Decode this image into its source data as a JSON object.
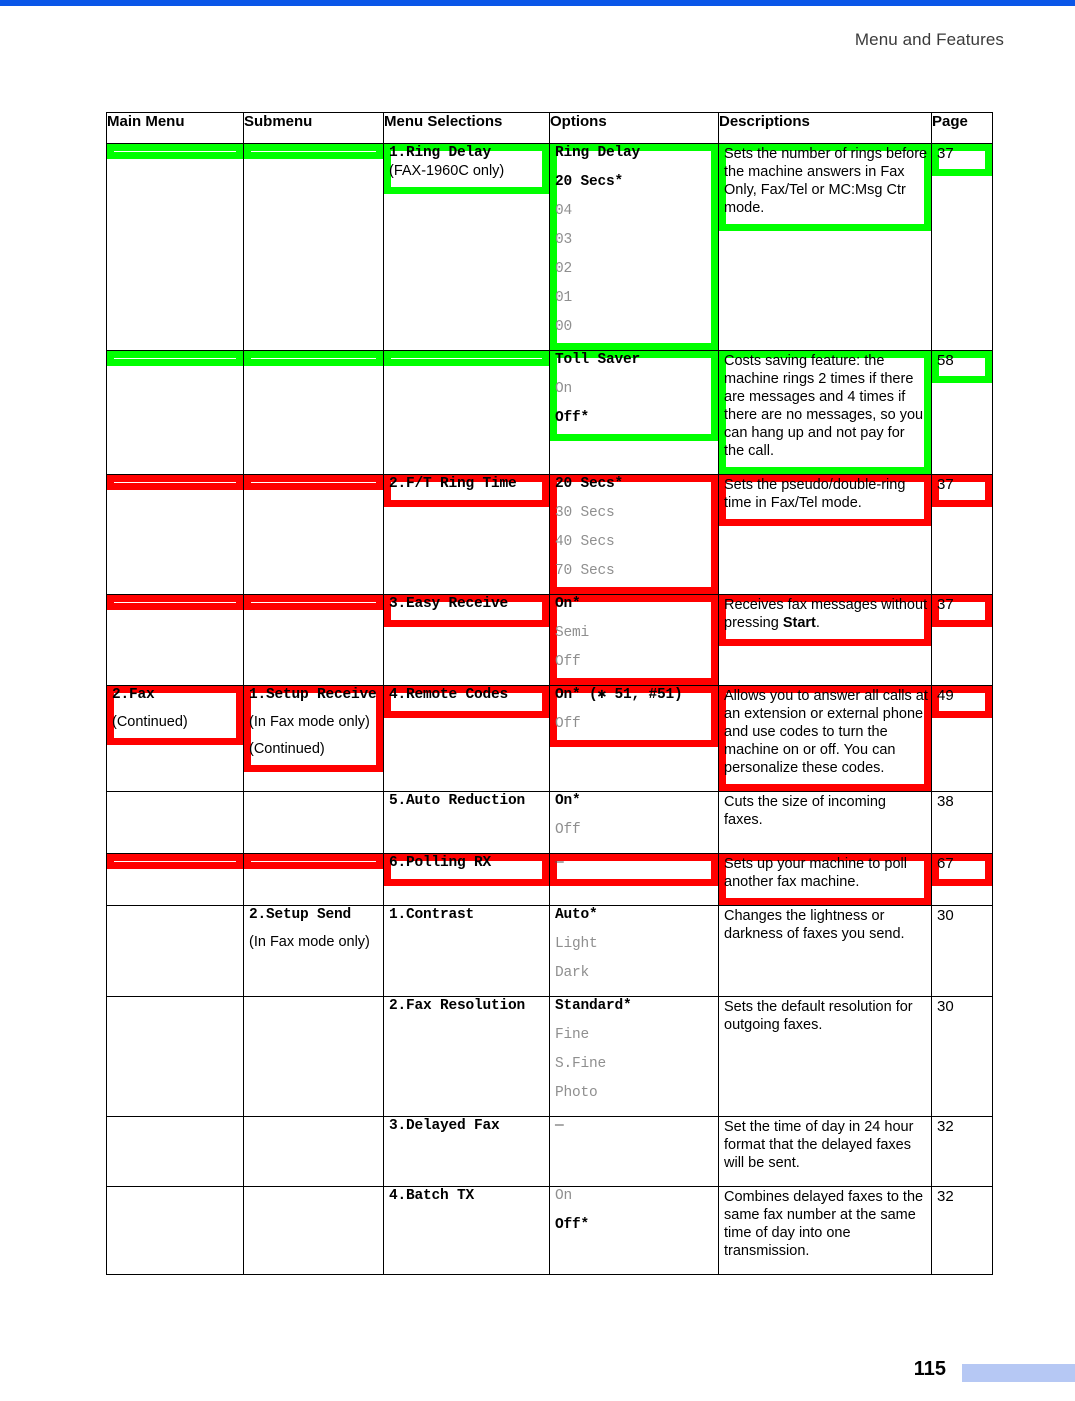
{
  "document": {
    "running_header": "Menu and Features",
    "page_number": "115",
    "accent_rule_color": "#0a56e8",
    "folio_bar_color": "#b6c8f4",
    "highlight_colors": {
      "green": "#00ff00",
      "red": "#ff0000"
    }
  },
  "table": {
    "headers": {
      "main_menu": "Main Menu",
      "submenu": "Submenu",
      "menu_selections": "Menu Selections",
      "options": "Options",
      "descriptions": "Descriptions",
      "page": "Page"
    },
    "rows": [
      {
        "highlight": "green",
        "main_menu": "",
        "submenu": "",
        "menu_selection": "1.Ring Delay",
        "menu_selection_note": "(FAX-1960C only)",
        "options": [
          {
            "text": "Ring Delay",
            "style": "bold"
          },
          {
            "text": "20 Secs*",
            "style": "bold"
          },
          {
            "text": "04",
            "style": "gray"
          },
          {
            "text": "03",
            "style": "gray"
          },
          {
            "text": "02",
            "style": "gray"
          },
          {
            "text": "01",
            "style": "gray"
          },
          {
            "text": "00",
            "style": "gray"
          }
        ],
        "description": "Sets the number of rings before the machine answers in Fax Only, Fax/Tel or MC:Msg Ctr mode.",
        "page": "37"
      },
      {
        "highlight": "green",
        "main_menu": "",
        "submenu": "",
        "menu_selection": "",
        "menu_selection_note": "",
        "options": [
          {
            "text": "Toll Saver",
            "style": "bold"
          },
          {
            "text": "On",
            "style": "gray"
          },
          {
            "text": "Off*",
            "style": "bold"
          }
        ],
        "description": "Costs saving feature: the machine rings 2 times if there are messages and 4 times if there are no messages, so you can hang up and not pay for the call.",
        "page": "58"
      },
      {
        "highlight": "red",
        "main_menu": "",
        "submenu": "",
        "menu_selection": "2.F/T Ring Time",
        "menu_selection_note": "",
        "options": [
          {
            "text": "20 Secs*",
            "style": "bold"
          },
          {
            "text": "30 Secs",
            "style": "gray"
          },
          {
            "text": "40 Secs",
            "style": "gray"
          },
          {
            "text": "70 Secs",
            "style": "gray"
          }
        ],
        "description": "Sets the pseudo/double-ring time in Fax/Tel mode.",
        "page": "37"
      },
      {
        "highlight": "red",
        "main_menu": "",
        "submenu": "",
        "menu_selection": "3.Easy Receive",
        "menu_selection_note": "",
        "options": [
          {
            "text": "On*",
            "style": "bold"
          },
          {
            "text": "Semi",
            "style": "gray"
          },
          {
            "text": "Off",
            "style": "gray"
          }
        ],
        "description_html": "Receives fax messages without pressing <b>Start</b>.",
        "description": "Receives fax messages without pressing Start.",
        "page": "37"
      },
      {
        "highlight": "red",
        "main_menu": "2.Fax",
        "main_menu_note": "(Continued)",
        "submenu": "1.Setup Receive",
        "submenu_note": "(In Fax mode only)",
        "submenu_note2": "(Continued)",
        "menu_selection": "4.Remote Codes",
        "menu_selection_note": "",
        "options": [
          {
            "text": "On* (✱ 51, #51)",
            "style": "bold-mixed"
          },
          {
            "text": "Off",
            "style": "gray"
          }
        ],
        "description": "Allows you to answer all calls at an extension or external phone and use codes to turn the machine on or off. You can personalize these codes.",
        "page": "49"
      },
      {
        "highlight": "none",
        "main_menu": "",
        "submenu": "",
        "menu_selection": "5.Auto Reduction",
        "menu_selection_note": "",
        "options": [
          {
            "text": "On*",
            "style": "bold"
          },
          {
            "text": "Off",
            "style": "gray"
          }
        ],
        "description": "Cuts the size of incoming faxes.",
        "page": "38"
      },
      {
        "highlight": "red",
        "main_menu": "",
        "submenu": "",
        "menu_selection": "6.Polling RX",
        "menu_selection_note": "",
        "options": [
          {
            "text": "—",
            "style": "dash"
          }
        ],
        "description": "Sets up your machine to poll another fax machine.",
        "page": "67"
      },
      {
        "highlight": "none",
        "main_menu": "",
        "submenu": "2.Setup Send",
        "submenu_note": "(In Fax mode only)",
        "menu_selection": "1.Contrast",
        "menu_selection_note": "",
        "options": [
          {
            "text": "Auto*",
            "style": "bold"
          },
          {
            "text": "Light",
            "style": "gray"
          },
          {
            "text": "Dark",
            "style": "gray"
          }
        ],
        "description": "Changes the lightness or darkness of faxes you send.",
        "page": "30"
      },
      {
        "highlight": "none",
        "main_menu": "",
        "submenu": "",
        "menu_selection": "2.Fax Resolution",
        "menu_selection_note": "",
        "options": [
          {
            "text": "Standard*",
            "style": "bold"
          },
          {
            "text": "Fine",
            "style": "gray"
          },
          {
            "text": "S.Fine",
            "style": "gray"
          },
          {
            "text": "Photo",
            "style": "gray"
          }
        ],
        "description": "Sets the default resolution for outgoing faxes.",
        "page": "30"
      },
      {
        "highlight": "none",
        "main_menu": "",
        "submenu": "",
        "menu_selection": "3.Delayed Fax",
        "menu_selection_note": "",
        "options": [
          {
            "text": "—",
            "style": "dash"
          }
        ],
        "description": "Set the time of day in 24 hour format that the delayed faxes will be sent.",
        "page": "32"
      },
      {
        "highlight": "none",
        "main_menu": "",
        "submenu": "",
        "menu_selection": "4.Batch TX",
        "menu_selection_note": "",
        "options": [
          {
            "text": "On",
            "style": "gray"
          },
          {
            "text": "Off*",
            "style": "bold"
          }
        ],
        "description": "Combines delayed faxes to the same fax number at the same time of day into one transmission.",
        "page": "32"
      }
    ]
  }
}
